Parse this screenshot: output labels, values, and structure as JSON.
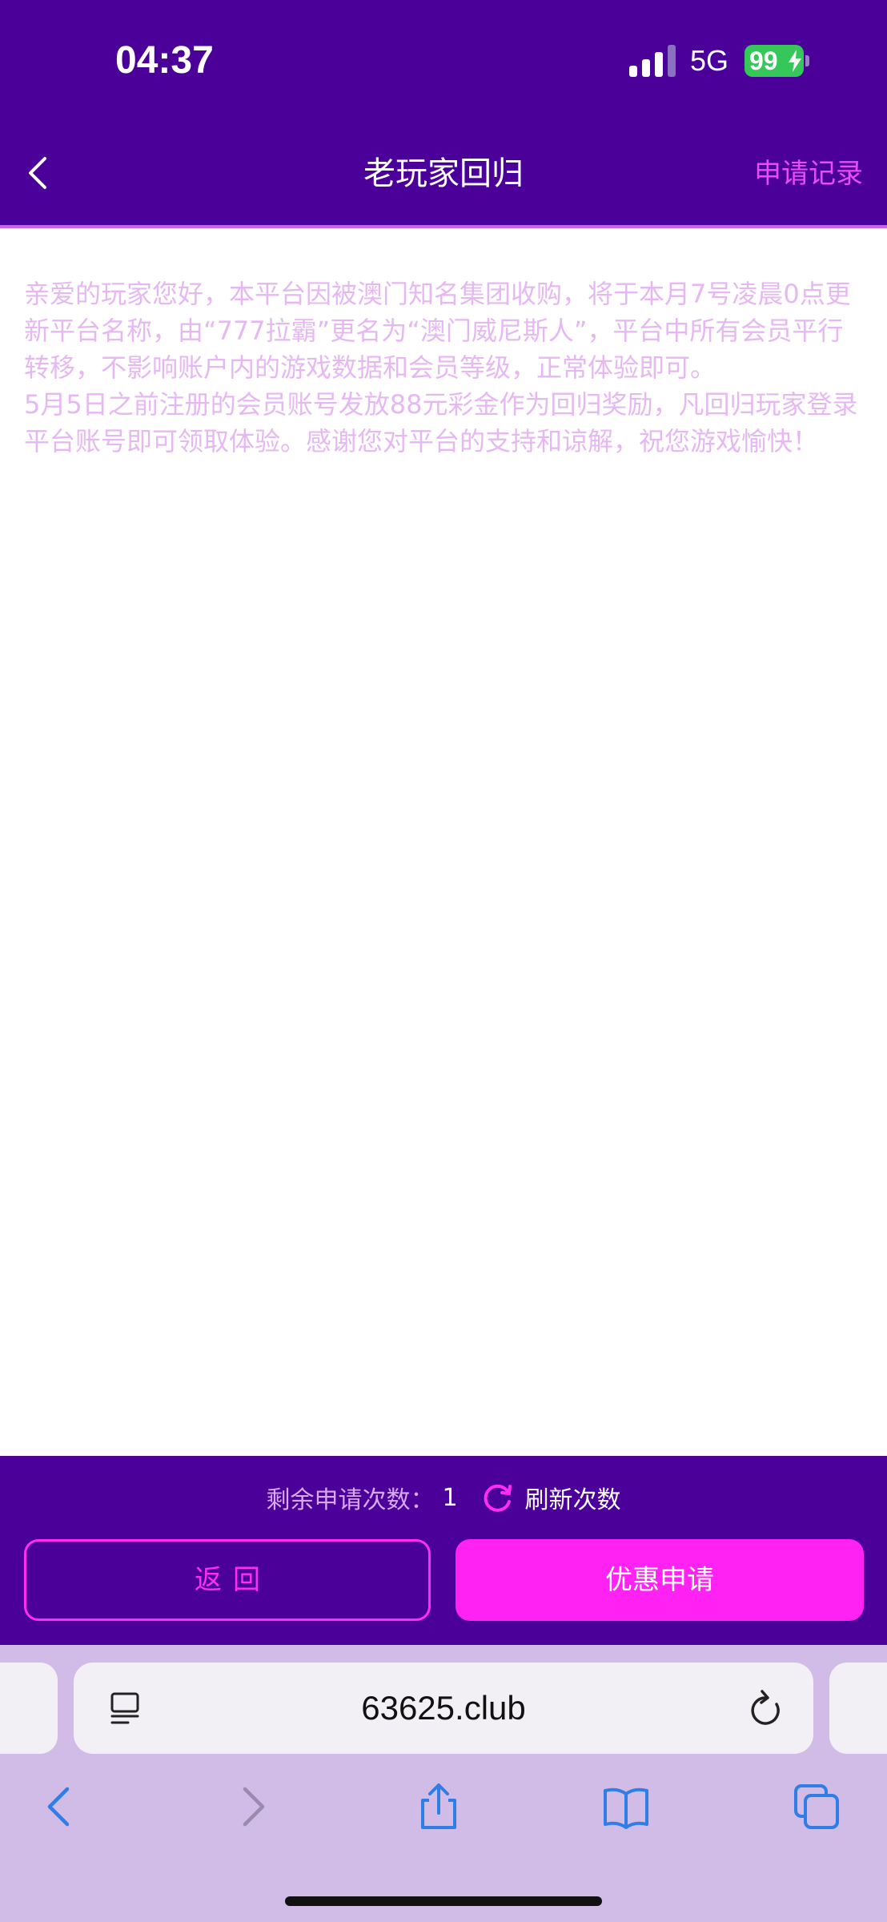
{
  "status_bar": {
    "time": "04:37",
    "network": "5G",
    "battery": "99"
  },
  "header": {
    "title": "老玩家回归",
    "record_link": "申请记录"
  },
  "content": {
    "body": "亲爱的玩家您好，本平台因被澳门知名集团收购，将于本月7号凌晨0点更新平台名称，由“777拉霸”更名为“澳门威尼斯人”，平台中所有会员平行转移，不影响账户内的游戏数据和会员等级，正常体验即可。\n5月5日之前注册的会员账号发放88元彩金作为回归奖励，凡回归玩家登录平台账号即可领取体验。感谢您对平台的支持和谅解，祝您游戏愉快！"
  },
  "actions": {
    "remaining_label": "剩余申请次数：",
    "remaining_count": "1",
    "refresh_label": "刷新次数",
    "back_label": "返回",
    "apply_label": "优惠申请"
  },
  "browser": {
    "url": "63625.club"
  },
  "colors": {
    "header_bg": "#4a0099",
    "accent_magenta": "#ff22f2",
    "content_text": "#e6b8f2",
    "browser_bg": "#d0bce6",
    "icon_blue": "#2f7ee8"
  }
}
